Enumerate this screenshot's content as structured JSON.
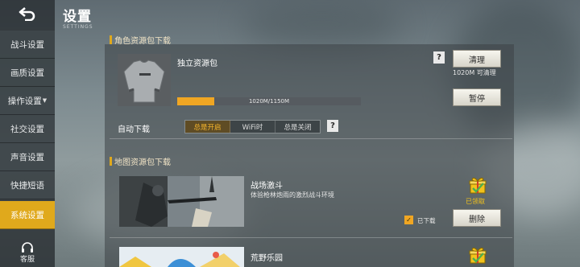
{
  "header": {
    "title": "设置",
    "subtitle": "SETTINGS"
  },
  "sidebar": {
    "items": [
      {
        "label": "战斗设置"
      },
      {
        "label": "画质设置"
      },
      {
        "label": "操作设置"
      },
      {
        "label": "社交设置"
      },
      {
        "label": "声音设置"
      },
      {
        "label": "快捷短语"
      },
      {
        "label": "系统设置"
      }
    ],
    "active_index": 6,
    "service_label": "客服"
  },
  "role_section": {
    "title": "角色资源包下载",
    "pack_name": "独立资源包",
    "progress_text": "1020M/1150M",
    "progress_fraction": 0.2,
    "clear_button": "清理",
    "clear_note": "1020M 可清理",
    "pause_button": "暂停",
    "auto_download_label": "自动下载",
    "auto_options": [
      "总是开启",
      "WiFi时",
      "总是关闭"
    ],
    "auto_selected": "总是开启",
    "help": "?"
  },
  "map_section": {
    "title": "地图资源包下载",
    "maps": [
      {
        "title": "战场激斗",
        "desc": "体验枪林炮雨的激烈战斗环境",
        "claimed": "已领取",
        "downloaded_label": "已下载",
        "delete_button": "删除"
      },
      {
        "title": "荒野乐园"
      }
    ]
  },
  "colors": {
    "accent": "#e0a91c",
    "progress": "#f0a623"
  }
}
